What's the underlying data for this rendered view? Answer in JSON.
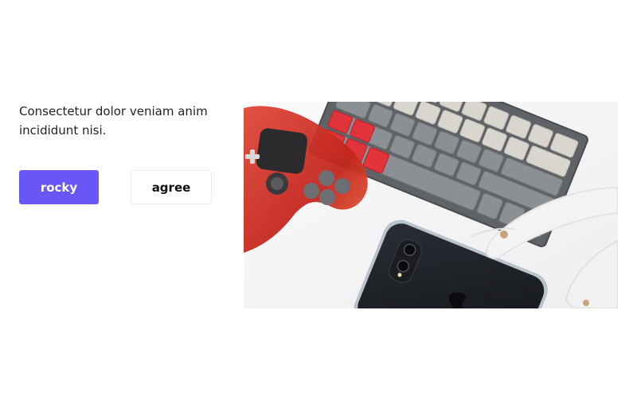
{
  "hero": {
    "text": "Consectetur dolor veniam anim incididunt nisi.",
    "primary_button_label": "rocky",
    "secondary_button_label": "agree",
    "image_subject_icons": [
      "gamepad-icon",
      "keyboard-icon",
      "smartphone-icon",
      "headphones-icon"
    ]
  },
  "colors": {
    "primary_button": "#6a56f6",
    "text": "#1f1f1f"
  }
}
